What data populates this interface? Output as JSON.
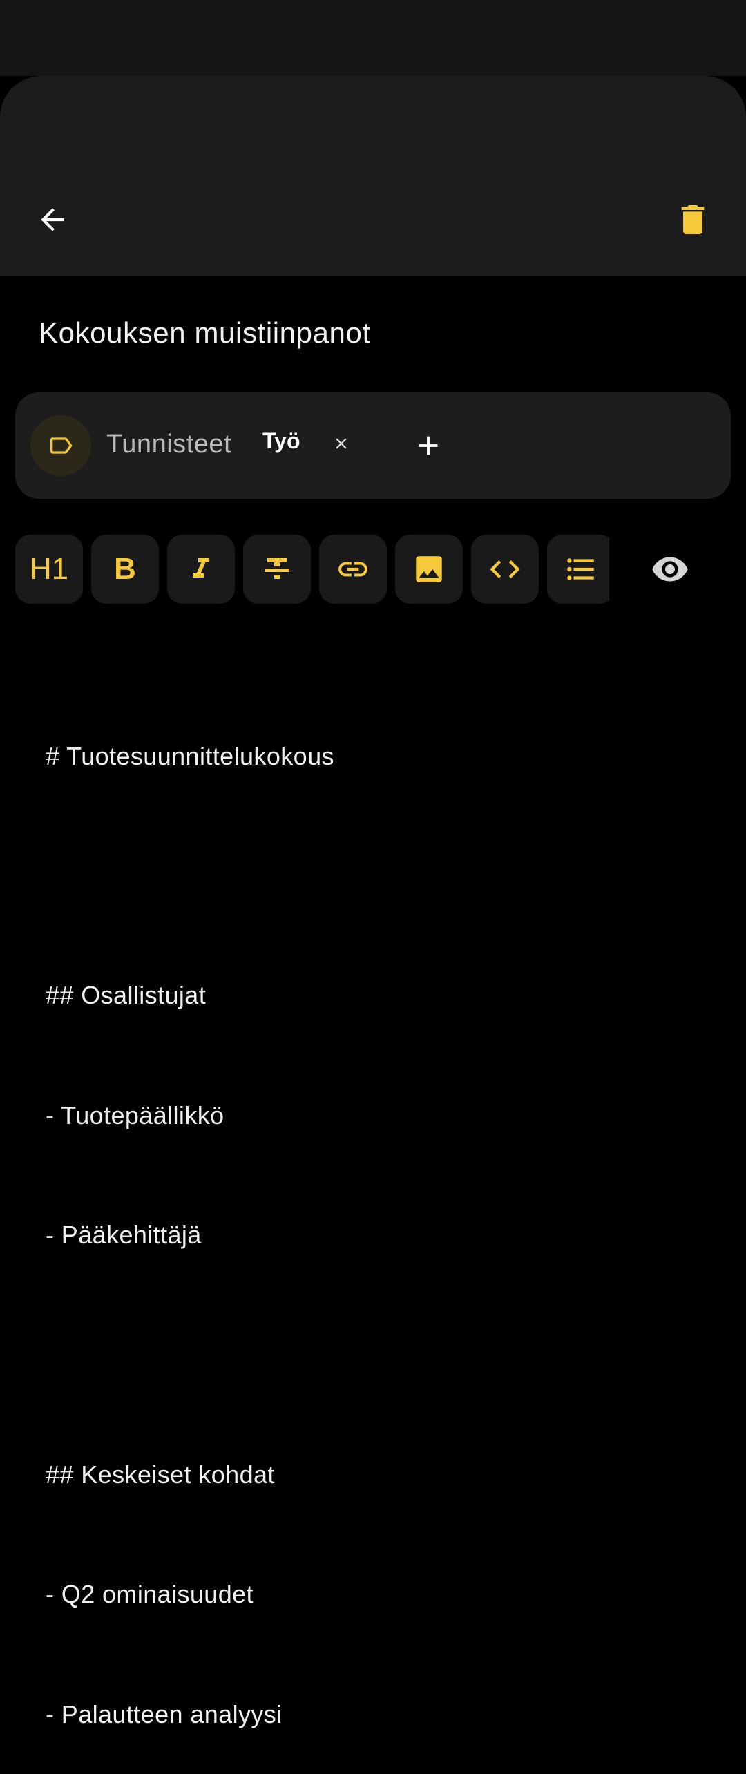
{
  "app_bar": {
    "back_icon": "arrow-left-icon",
    "delete_icon": "trash-icon",
    "accent_color": "#F5C93A"
  },
  "note": {
    "title": "Kokouksen muistiinpanot"
  },
  "tags": {
    "label": "Tunnisteet",
    "items": [
      {
        "name": "Työ",
        "remove_symbol": "×"
      }
    ],
    "add_symbol": "+"
  },
  "toolbar": {
    "h1_label": "H1",
    "bold_label": "B",
    "buttons": [
      "heading",
      "bold",
      "italic",
      "strikethrough",
      "link",
      "image",
      "code",
      "bulleted-list"
    ],
    "preview_icon": "eye-icon"
  },
  "editor": {
    "lines": [
      "# Tuotesuunnittelukokous",
      "",
      "## Osallistujat",
      "- Tuotepäällikkö",
      "- Pääkehittäjä",
      "",
      "## Keskeiset kohdat",
      "- Q2 ominaisuudet",
      "- Palautteen analyysi"
    ]
  }
}
